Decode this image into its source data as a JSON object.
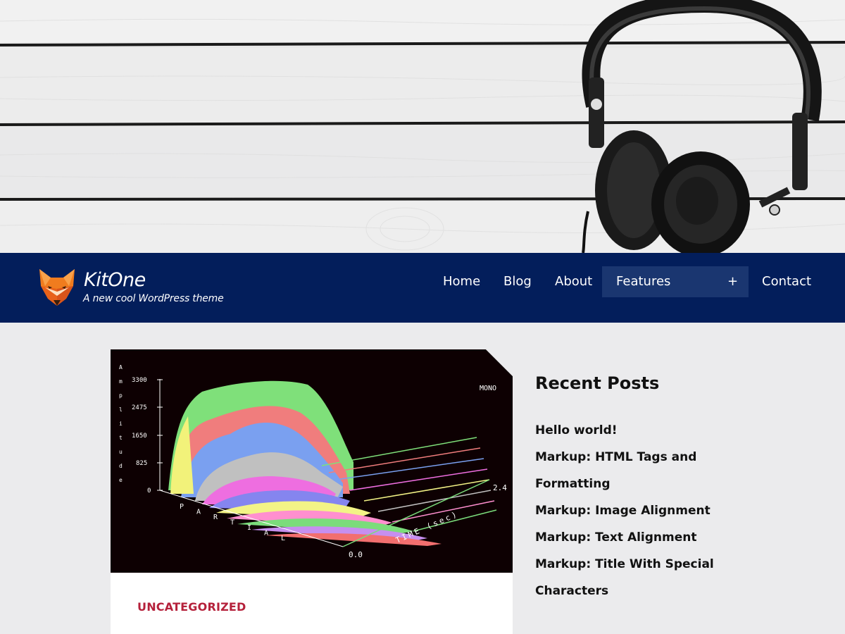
{
  "site": {
    "title": "KitOne",
    "description": "A new cool WordPress theme"
  },
  "nav": {
    "items": [
      {
        "label": "Home"
      },
      {
        "label": "Blog"
      },
      {
        "label": "About"
      },
      {
        "label": "Features",
        "has_submenu": true,
        "toggle": "+"
      },
      {
        "label": "Contact"
      }
    ]
  },
  "post": {
    "category": "UNCATEGORIZED",
    "thumbnail": {
      "badge": "MONO",
      "y_axis_label": "Amplitude",
      "y_ticks": [
        "3300",
        "2475",
        "1650",
        "825",
        "0"
      ],
      "x_axis_label": "PARTIAL",
      "x_ticks": [
        "1",
        "5",
        "10",
        "15",
        "20"
      ],
      "z_axis_label": "TIME (sec)",
      "z_ticks": [
        "0.0",
        "2.4"
      ]
    }
  },
  "sidebar": {
    "widget_title": "Recent Posts",
    "recent_posts": [
      "Hello world!",
      "Markup: HTML Tags and Formatting",
      "Markup: Image Alignment",
      "Markup: Text Alignment",
      "Markup: Title With Special Characters"
    ]
  },
  "colors": {
    "navbar_bg": "#031e5b",
    "features_bg": "#1a3670",
    "category": "#b5213b",
    "page_bg": "#ebebed"
  },
  "icons": {
    "logo": "fox-head-icon",
    "hero": "headphones-icon"
  }
}
